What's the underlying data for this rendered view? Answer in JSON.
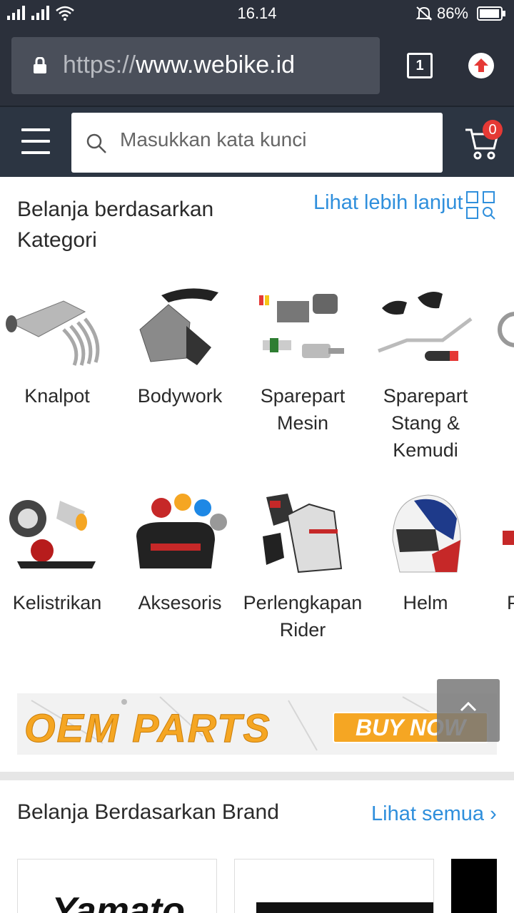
{
  "status_bar": {
    "time": "16.14",
    "battery": "86%"
  },
  "browser": {
    "url_scheme": "https://",
    "url_host": "www.webike.id",
    "tab_count": "1"
  },
  "header": {
    "search_placeholder": "Masukkan kata kunci",
    "cart_count": "0"
  },
  "categories_section": {
    "title": "Belanja berdasarkan Kategori",
    "more_label": "Lihat lebih lanjut",
    "items": [
      {
        "label": "Knalpot",
        "icon": "exhaust-image"
      },
      {
        "label": "Bodywork",
        "icon": "bodywork-image"
      },
      {
        "label": "Sparepart Mesin",
        "icon": "engine-parts-image"
      },
      {
        "label": "Sparepart Stang & Kemudi",
        "icon": "handlebar-parts-image"
      },
      {
        "label": "Kelistrikan",
        "icon": "electrical-image"
      },
      {
        "label": "Aksesoris",
        "icon": "accessories-image"
      },
      {
        "label": "Perlengkapan Rider",
        "icon": "rider-gear-image"
      },
      {
        "label": "Helm",
        "icon": "helmet-image"
      },
      {
        "label": "P",
        "icon": "partial-category-image"
      }
    ]
  },
  "banner": {
    "title": "OEM PARTS",
    "cta": "BUY NOW"
  },
  "brands_section": {
    "title": "Belanja Berdasarkan Brand",
    "more_label": "Lihat semua",
    "brand_text": "Yamato"
  },
  "colors": {
    "accent_link": "#2f8fdc",
    "header_bg": "#2c3542",
    "badge": "#e53935",
    "banner_orange": "#f5a623"
  }
}
